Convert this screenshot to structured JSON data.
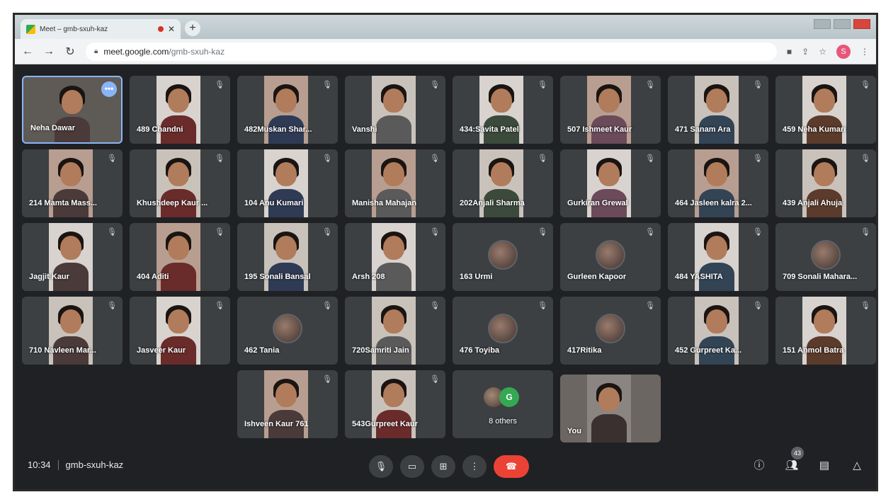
{
  "browser": {
    "tab_title": "Meet – gmb-sxuh-kaz",
    "url_host": "meet.google.com",
    "url_path": "/gmb-sxuh-kaz",
    "profile_initial": "S"
  },
  "participants": [
    "Neha Dawar",
    "489 Chandni",
    "482Muskan Shar...",
    "Vanshi",
    "434:Savita Patel",
    "507 Ishmeet Kaur",
    "471 Sanam Ara",
    "459 Neha Kumari",
    "214 Mamta Mass...",
    "Khushdeep Kaur ...",
    "104 Anu Kumari",
    "Manisha Mahajan",
    "202Anjali Sharma",
    "Gurkiran Grewal",
    "464 Jasleen kalra 2...",
    "439 Anjali Ahuja",
    "Jagjit Kaur",
    "404 Aditi",
    "195 Sonali Bansal",
    "Arsh 208",
    "163 Urmi",
    "Gurleen Kapoor",
    "484 YASHITA",
    "709 Sonali Mahara...",
    "710 Navleen Mar...",
    "Jasveer Kaur",
    "462 Tania",
    "720Samriti Jain",
    "476 Toyiba",
    "417Ritika",
    "452 Gurpreet Ka...",
    "151 Anmol Batra",
    "Ishveen Kaur 761",
    "543Gurpreet Kaur"
  ],
  "others_tile": {
    "avatar_letter": "G",
    "label": "8 others"
  },
  "self_tile": {
    "label": "You"
  },
  "bottom_bar": {
    "time": "10:34",
    "meeting_code": "gmb-sxuh-kaz",
    "participant_count": "43"
  },
  "colors": {
    "background": "#202124",
    "tile": "#3c4043",
    "hangup": "#ea4335",
    "self_outline": "#8ab4f8"
  }
}
